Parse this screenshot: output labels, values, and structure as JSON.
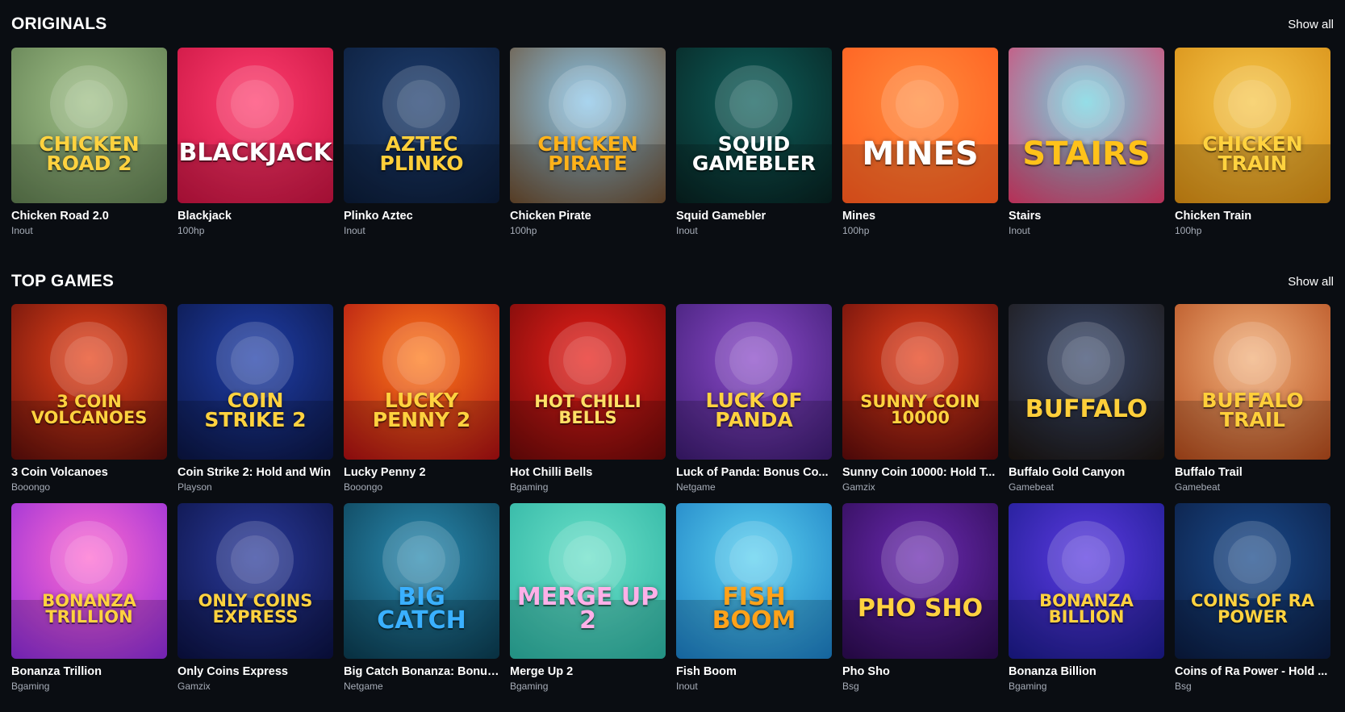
{
  "sections": [
    {
      "title": "ORIGINALS",
      "show_all": "Show all",
      "rows": [
        [
          {
            "name": "Chicken Road 2.0",
            "provider": "Inout",
            "art": "CHICKEN ROAD 2",
            "icon": "chicken-road-icon",
            "colors": [
              "#9fbf87",
              "#5d7a4e"
            ],
            "text_color": "#ffd23f"
          },
          {
            "name": "Blackjack",
            "provider": "100hp",
            "art": "BLACKJACK",
            "icon": "playing-cards-icon",
            "colors": [
              "#ff3d6e",
              "#c4123f"
            ],
            "text_color": "#ffffff"
          },
          {
            "name": "Plinko Aztec",
            "provider": "Inout",
            "art": "AZTEC PLINKO",
            "icon": "aztec-temple-icon",
            "colors": [
              "#1d3d6e",
              "#0b1b36"
            ],
            "text_color": "#ffcf3a"
          },
          {
            "name": "Chicken Pirate",
            "provider": "100hp",
            "art": "Chicken Pirate",
            "icon": "pirate-chicken-icon",
            "colors": [
              "#8ac6ea",
              "#6a4a2c"
            ],
            "text_color": "#ffb21a"
          },
          {
            "name": "Squid Gamebler",
            "provider": "Inout",
            "art": "SQUID GAMEBLER",
            "icon": "squid-guard-icon",
            "colors": [
              "#0e5e5a",
              "#07201f"
            ],
            "text_color": "#ffffff"
          },
          {
            "name": "Mines",
            "provider": "100hp",
            "art": "MINES",
            "icon": "bomb-icon",
            "colors": [
              "#ff8a3a",
              "#ff5a1e"
            ],
            "text_color": "#ffffff"
          },
          {
            "name": "Stairs",
            "provider": "Inout",
            "art": "STAIRS",
            "icon": "stairs-climber-icon",
            "colors": [
              "#6fd3e0",
              "#e03a6a"
            ],
            "text_color": "#ffc21a"
          },
          {
            "name": "Chicken Train",
            "provider": "100hp",
            "art": "CHICKEN TRAIN",
            "icon": "chicken-train-icon",
            "colors": [
              "#f6c64a",
              "#d48a12"
            ],
            "text_color": "#ffd23f"
          }
        ]
      ]
    },
    {
      "title": "TOP GAMES",
      "show_all": "Show all",
      "rows": [
        [
          {
            "name": "3 Coin Volcanoes",
            "provider": "Booongo",
            "art": "3 COIN VOLCANOES",
            "icon": "volcano-icon",
            "colors": [
              "#e8431a",
              "#5a0d0a"
            ],
            "text_color": "#ffd23f"
          },
          {
            "name": "Coin Strike 2: Hold and Win",
            "provider": "Playson",
            "art": "COIN STRIKE 2",
            "icon": "lightning-coin-icon",
            "colors": [
              "#1f3ea8",
              "#0a1440"
            ],
            "text_color": "#ffd23f"
          },
          {
            "name": "Lucky Penny 2",
            "provider": "Booongo",
            "art": "LUCKY PENNY 2",
            "icon": "leprechaun-icon",
            "colors": [
              "#ff7a1a",
              "#a80d12"
            ],
            "text_color": "#ffd23f"
          },
          {
            "name": "Hot Chilli Bells",
            "provider": "Bgaming",
            "art": "Hot Chilli Bells",
            "icon": "chilli-bell-icon",
            "colors": [
              "#e8201a",
              "#6a0808"
            ],
            "text_color": "#ffe066"
          },
          {
            "name": "Luck of Panda: Bonus Co...",
            "provider": "Netgame",
            "art": "LUCK OF PANDA",
            "icon": "panda-icon",
            "colors": [
              "#8a4ac8",
              "#3a1a6e"
            ],
            "text_color": "#ffd23f"
          },
          {
            "name": "Sunny Coin 10000: Hold T...",
            "provider": "Gamzix",
            "art": "SUNNY COIN 10000",
            "icon": "queen-icon",
            "colors": [
              "#e8401a",
              "#5a0a0a"
            ],
            "text_color": "#ffd23f"
          },
          {
            "name": "Buffalo Gold Canyon",
            "provider": "Gamebeat",
            "art": "BUFFALO",
            "icon": "buffalo-icon",
            "colors": [
              "#3a4a6e",
              "#1a1410"
            ],
            "text_color": "#ffcf3a"
          },
          {
            "name": "Buffalo Trail",
            "provider": "Gamebeat",
            "art": "BUFFALO TRAIL",
            "icon": "buffalo-icon",
            "colors": [
              "#f2b07a",
              "#b0481a"
            ],
            "text_color": "#ffcf3a"
          }
        ],
        [
          {
            "name": "Bonanza Trillion",
            "provider": "Bgaming",
            "art": "BONANZA TRILLION",
            "icon": "clover-icon",
            "colors": [
              "#ff6ad0",
              "#8a2ad8"
            ],
            "text_color": "#ffd23f"
          },
          {
            "name": "Only Coins Express",
            "provider": "Gamzix",
            "art": "ONLY COINS EXPRESS",
            "icon": "train-icon",
            "colors": [
              "#2a3a9a",
              "#0a1040"
            ],
            "text_color": "#ffd23f"
          },
          {
            "name": "Big Catch Bonanza: Bonus...",
            "provider": "Netgame",
            "art": "BIG CATCH",
            "icon": "fisherman-icon",
            "colors": [
              "#2a8ab0",
              "#0a3a4e"
            ],
            "text_color": "#3ab0ff"
          },
          {
            "name": "Merge Up 2",
            "provider": "Bgaming",
            "art": "MERGE UP 2",
            "icon": "candy-ball-icon",
            "colors": [
              "#6ae0c8",
              "#2ab0a0"
            ],
            "text_color": "#ffb0e8"
          },
          {
            "name": "Fish Boom",
            "provider": "Inout",
            "art": "FISH BOOM",
            "icon": "fish-icon",
            "colors": [
              "#5ad0f0",
              "#1a7ac0"
            ],
            "text_color": "#ffa21a"
          },
          {
            "name": "Pho Sho",
            "provider": "Bsg",
            "art": "PHO SHO",
            "icon": "noodle-chef-icon",
            "colors": [
              "#6a2ab0",
              "#2a0a4e"
            ],
            "text_color": "#ffd23f"
          },
          {
            "name": "Bonanza Billion",
            "provider": "Bgaming",
            "art": "BONANZA BILLION",
            "icon": "candy-icon",
            "colors": [
              "#5a3ae0",
              "#1a1a8a"
            ],
            "text_color": "#ffd23f"
          },
          {
            "name": "Coins of Ra Power - Hold ...",
            "provider": "Bsg",
            "art": "COINS OF RA POWER",
            "icon": "scarab-icon",
            "colors": [
              "#1a4a8a",
              "#0a1a3e"
            ],
            "text_color": "#ffd23f"
          }
        ]
      ]
    }
  ]
}
